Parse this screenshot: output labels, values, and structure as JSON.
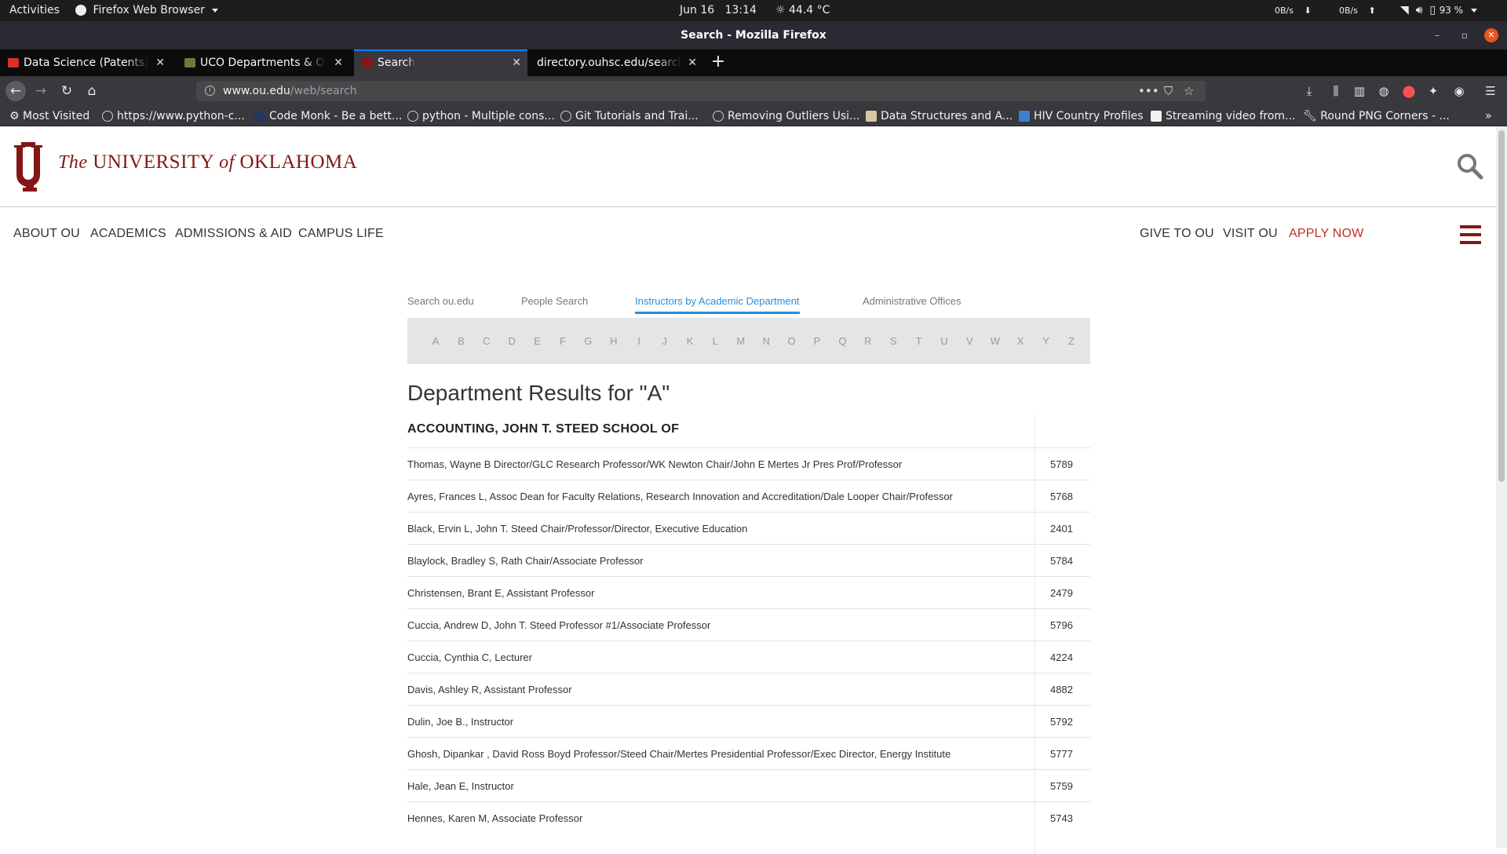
{
  "system_bar": {
    "activities": "Activities",
    "app_name": "Firefox Web Browser",
    "date": "Jun 16",
    "time": "13:14",
    "temperature": "44.4 °C",
    "net_down": "0B/s",
    "net_up": "0B/s",
    "battery": "93 %"
  },
  "window": {
    "title": "Search - Mozilla Firefox"
  },
  "tabs": [
    {
      "label": "Data Science (Patents) In",
      "favicon_color": "#d93025",
      "active": false
    },
    {
      "label": "UCO Departments & Offi",
      "favicon_color": "#6b7b3a",
      "active": false
    },
    {
      "label": "Search",
      "favicon_color": "#841617",
      "active": true
    },
    {
      "label": "directory.ouhsc.edu/search",
      "favicon_color": "",
      "active": false
    }
  ],
  "address_bar": {
    "host": "www.ou.edu",
    "path": "/web/search"
  },
  "bookmarks": [
    "Most Visited",
    "https://www.python-c...",
    "Code Monk - Be a bett...",
    "python - Multiple cons...",
    "Git Tutorials and Trai...",
    "Removing Outliers Usi...",
    "Data Structures and A...",
    "HIV Country Profiles",
    "Streaming video from...",
    "Round PNG Corners - ..."
  ],
  "site": {
    "wordmark_the": "The",
    "wordmark_university": "UNIVERSITY",
    "wordmark_of": "of",
    "wordmark_state": "OKLAHOMA",
    "brand_color": "#841617",
    "nav_left": [
      "ABOUT OU",
      "ACADEMICS",
      "ADMISSIONS & AID",
      "CAMPUS LIFE"
    ],
    "nav_right": [
      "GIVE TO OU",
      "VISIT OU",
      "APPLY NOW"
    ]
  },
  "search_tabs": [
    "Search ou.edu",
    "People Search",
    "Instructors by Academic Department",
    "Administrative Offices"
  ],
  "active_search_tab": "Instructors by Academic Department",
  "letters": [
    "A",
    "B",
    "C",
    "D",
    "E",
    "F",
    "G",
    "H",
    "I",
    "J",
    "K",
    "L",
    "M",
    "N",
    "O",
    "P",
    "Q",
    "R",
    "S",
    "T",
    "U",
    "V",
    "W",
    "X",
    "Y",
    "Z"
  ],
  "results": {
    "title": "Department Results for \"A\"",
    "department": "ACCOUNTING, JOHN T. STEED SCHOOL OF",
    "rows": [
      {
        "name": "Thomas, Wayne B Director/GLC Research Professor/WK Newton Chair/John E Mertes Jr Pres Prof/Professor",
        "ext": "5789"
      },
      {
        "name": "Ayres, Frances L, Assoc Dean for Faculty Relations, Research Innovation and Accreditation/Dale Looper Chair/Professor",
        "ext": "5768"
      },
      {
        "name": "Black, Ervin L, John T. Steed Chair/Professor/Director, Executive Education",
        "ext": "2401"
      },
      {
        "name": "Blaylock, Bradley S, Rath Chair/Associate Professor",
        "ext": "5784"
      },
      {
        "name": "Christensen, Brant E, Assistant Professor",
        "ext": "2479"
      },
      {
        "name": "Cuccia, Andrew D, John T. Steed Professor #1/Associate Professor",
        "ext": "5796"
      },
      {
        "name": "Cuccia, Cynthia C, Lecturer",
        "ext": "4224"
      },
      {
        "name": "Davis, Ashley R, Assistant Professor",
        "ext": "4882"
      },
      {
        "name": "Dulin, Joe B., Instructor",
        "ext": "5792"
      },
      {
        "name": "Ghosh, Dipankar , David Ross Boyd Professor/Steed Chair/Mertes Presidential Professor/Exec Director, Energy Institute",
        "ext": "5777"
      },
      {
        "name": "Hale, Jean E, Instructor",
        "ext": "5759"
      },
      {
        "name": "Hennes, Karen M, Associate Professor",
        "ext": "5743"
      }
    ]
  }
}
